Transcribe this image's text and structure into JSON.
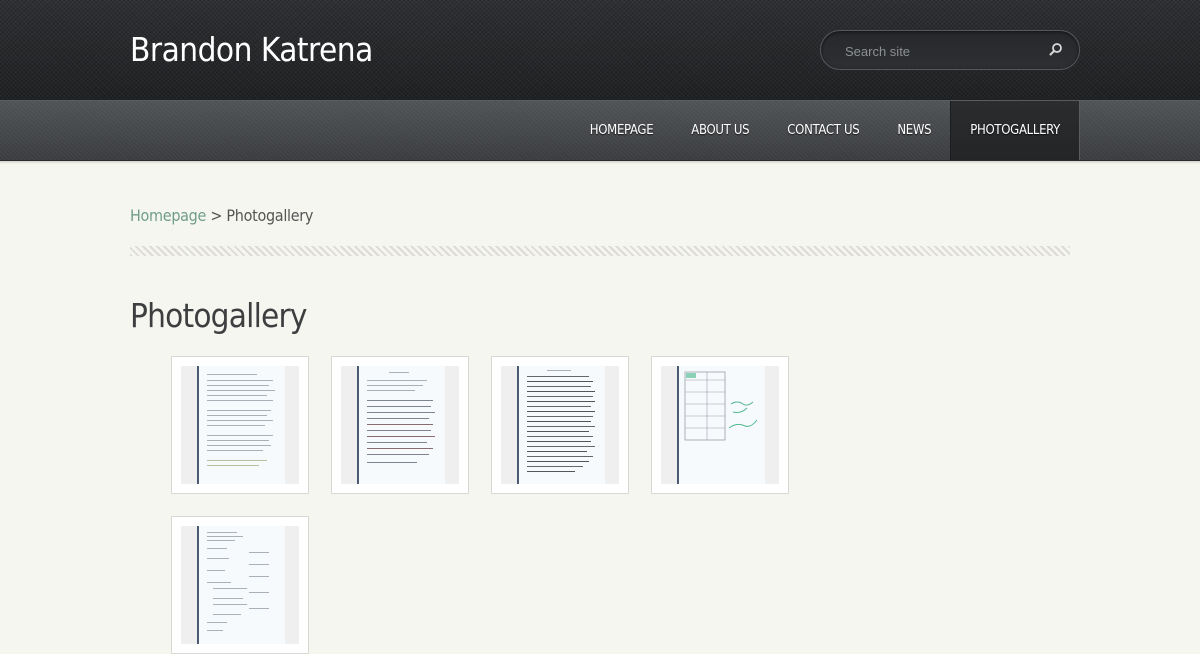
{
  "header": {
    "site_title": "Brandon Katrena",
    "search_placeholder": "Search site",
    "search_icon": "search-icon"
  },
  "nav": {
    "items": [
      {
        "label": "HOMEPAGE",
        "active": false
      },
      {
        "label": "ABOUT US",
        "active": false
      },
      {
        "label": "CONTACT US",
        "active": false
      },
      {
        "label": "NEWS",
        "active": false
      },
      {
        "label": "PHOTOGALLERY",
        "active": true
      }
    ]
  },
  "breadcrumb": {
    "home_link": "Homepage",
    "separator": ">",
    "current": "Photogallery"
  },
  "main": {
    "title": "Photogallery",
    "gallery": [
      {
        "kind": "typed-document"
      },
      {
        "kind": "handwritten-document"
      },
      {
        "kind": "dense-handwritten-document"
      },
      {
        "kind": "table-document"
      },
      {
        "kind": "form-document"
      }
    ]
  },
  "colors": {
    "header_bg": "#26282b",
    "nav_bg": "#45484b",
    "page_bg": "#f6f6f0",
    "link": "#6f9d8a",
    "title_text": "#3d3e40"
  }
}
